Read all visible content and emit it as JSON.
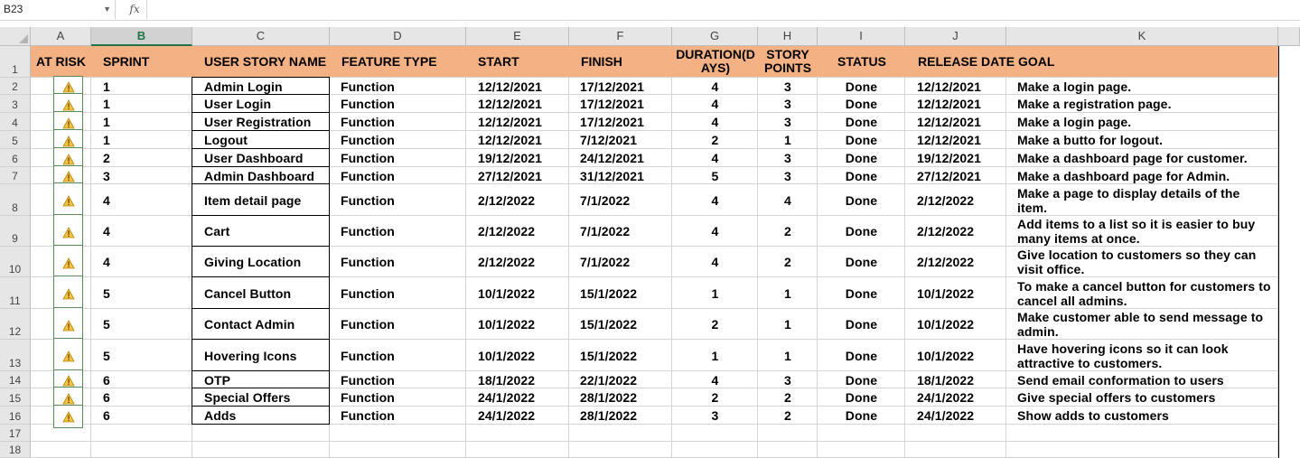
{
  "formula_bar": {
    "name_box": "B23",
    "fx_label": "fx",
    "formula": ""
  },
  "columns": [
    {
      "letter": "A"
    },
    {
      "letter": "B"
    },
    {
      "letter": "C"
    },
    {
      "letter": "D"
    },
    {
      "letter": "E"
    },
    {
      "letter": "F"
    },
    {
      "letter": "G"
    },
    {
      "letter": "H"
    },
    {
      "letter": "I"
    },
    {
      "letter": "J"
    },
    {
      "letter": "K"
    }
  ],
  "selected_column": "B",
  "row_numbers": [
    "1",
    "2",
    "3",
    "4",
    "5",
    "6",
    "7",
    "8",
    "9",
    "10",
    "11",
    "12",
    "13",
    "14",
    "15",
    "16",
    "17",
    "18"
  ],
  "header_fill": "#f4b183",
  "headers": {
    "at_risk": "AT RISK",
    "sprint": "SPRINT",
    "story": "USER STORY NAME",
    "feature": "FEATURE TYPE",
    "start": "START",
    "finish": "FINISH",
    "duration": "DURATION(D\nAYS)",
    "points": "STORY\nPOINTS",
    "status": "STATUS",
    "release": "RELEASE DATE",
    "goal": "GOAL"
  },
  "at_risk_icon": "warning-icon",
  "rows": [
    {
      "sprint": "1",
      "story": "Admin Login",
      "feature": "Function",
      "start": "12/12/2021",
      "finish": "17/12/2021",
      "duration": "4",
      "points": "3",
      "status": "Done",
      "release": "12/12/2021",
      "goal": "Make a login page."
    },
    {
      "sprint": "1",
      "story": "User Login",
      "feature": "Function",
      "start": "12/12/2021",
      "finish": "17/12/2021",
      "duration": "4",
      "points": "3",
      "status": "Done",
      "release": "12/12/2021",
      "goal": "Make a registration page."
    },
    {
      "sprint": "1",
      "story": "User Registration",
      "feature": "Function",
      "start": "12/12/2021",
      "finish": "17/12/2021",
      "duration": "4",
      "points": "3",
      "status": "Done",
      "release": "12/12/2021",
      "goal": "Make a login page."
    },
    {
      "sprint": "1",
      "story": "Logout",
      "feature": "Function",
      "start": "12/12/2021",
      "finish": "7/12/2021",
      "duration": "2",
      "points": "1",
      "status": "Done",
      "release": "12/12/2021",
      "goal": "Make a butto for logout."
    },
    {
      "sprint": "2",
      "story": "User Dashboard",
      "feature": "Function",
      "start": "19/12/2021",
      "finish": "24/12/2021",
      "duration": "4",
      "points": "3",
      "status": "Done",
      "release": "19/12/2021",
      "goal": "Make a dashboard page for customer."
    },
    {
      "sprint": "3",
      "story": "Admin Dashboard",
      "feature": "Function",
      "start": "27/12/2021",
      "finish": "31/12/2021",
      "duration": "5",
      "points": "3",
      "status": "Done",
      "release": "27/12/2021",
      "goal": "Make a dashboard page for Admin."
    },
    {
      "sprint": "4",
      "story": "Item detail page",
      "feature": "Function",
      "start": "2/12/2022",
      "finish": "7/1/2022",
      "duration": "4",
      "points": "4",
      "status": "Done",
      "release": "2/12/2022",
      "goal": "Make a page to display details of the item."
    },
    {
      "sprint": "4",
      "story": "Cart",
      "feature": "Function",
      "start": "2/12/2022",
      "finish": "7/1/2022",
      "duration": "4",
      "points": "2",
      "status": "Done",
      "release": "2/12/2022",
      "goal": "Add items to a list so it is easier to buy many items at once."
    },
    {
      "sprint": "4",
      "story": "Giving Location",
      "feature": "Function",
      "start": "2/12/2022",
      "finish": "7/1/2022",
      "duration": "4",
      "points": "2",
      "status": "Done",
      "release": "2/12/2022",
      "goal": "Give location to customers so they can visit office."
    },
    {
      "sprint": "5",
      "story": "Cancel Button",
      "feature": "Function",
      "start": "10/1/2022",
      "finish": "15/1/2022",
      "duration": "1",
      "points": "1",
      "status": "Done",
      "release": "10/1/2022",
      "goal": "To make a cancel button for customers to cancel all admins."
    },
    {
      "sprint": "5",
      "story": "Contact Admin",
      "feature": "Function",
      "start": "10/1/2022",
      "finish": "15/1/2022",
      "duration": "2",
      "points": "1",
      "status": "Done",
      "release": "10/1/2022",
      "goal": "Make customer able to send message to admin."
    },
    {
      "sprint": "5",
      "story": "Hovering Icons",
      "feature": "Function",
      "start": "10/1/2022",
      "finish": "15/1/2022",
      "duration": "1",
      "points": "1",
      "status": "Done",
      "release": "10/1/2022",
      "goal": "Have hovering icons so it can look attractive to customers."
    },
    {
      "sprint": "6",
      "story": "OTP",
      "feature": "Function",
      "start": "18/1/2022",
      "finish": "22/1/2022",
      "duration": "4",
      "points": "3",
      "status": "Done",
      "release": "18/1/2022",
      "goal": "Send email conformation to users"
    },
    {
      "sprint": "6",
      "story": "Special Offers",
      "feature": "Function",
      "start": "24/1/2022",
      "finish": "28/1/2022",
      "duration": "2",
      "points": "2",
      "status": "Done",
      "release": "24/1/2022",
      "goal": "Give special offers to customers"
    },
    {
      "sprint": "6",
      "story": "Adds",
      "feature": "Function",
      "start": "24/1/2022",
      "finish": "28/1/2022",
      "duration": "3",
      "points": "2",
      "status": "Done",
      "release": "24/1/2022",
      "goal": "Show adds to customers"
    }
  ]
}
